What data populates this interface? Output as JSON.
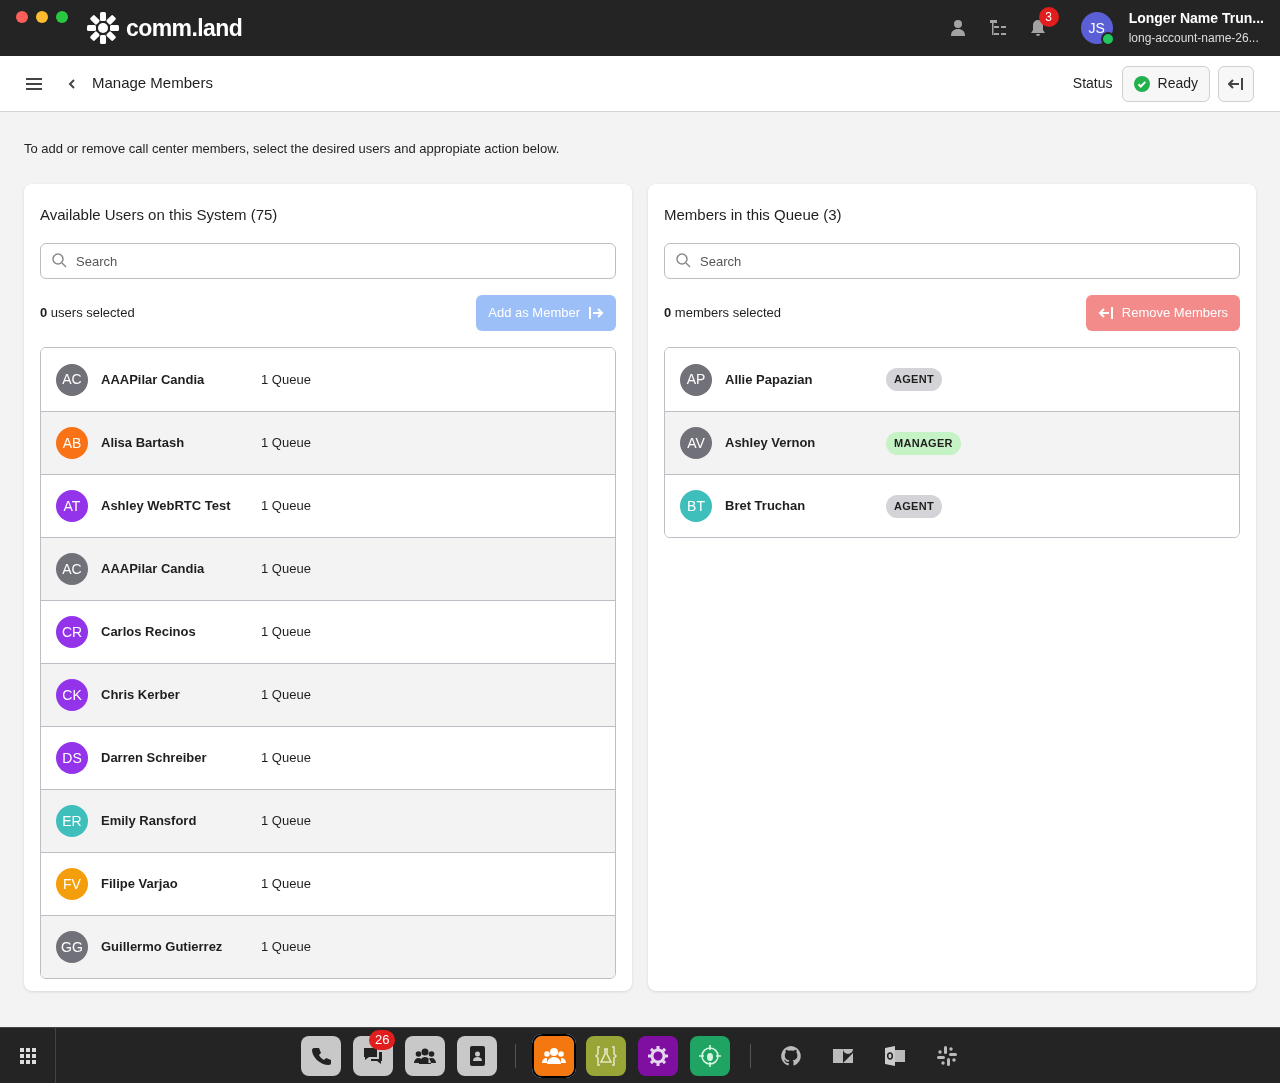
{
  "window": {
    "controls": [
      {
        "color": "#ff5f57"
      },
      {
        "color": "#febc2e"
      },
      {
        "color": "#28c840"
      }
    ]
  },
  "brand": {
    "name": "comm.land"
  },
  "top_bar": {
    "notification_count": "3",
    "user": {
      "initials": "JS",
      "name": "Longer Name Trun...",
      "account": "long-account-name-26..."
    }
  },
  "header": {
    "title": "Manage Members",
    "status_label": "Status",
    "status": "Ready"
  },
  "intro": "To add or remove call center members, select the desired users and appropiate action below.",
  "available": {
    "title": "Available Users on this System (75)",
    "search_placeholder": "Search",
    "selected_text": "**0** users selected",
    "action": "Add as Member",
    "rows": [
      {
        "initials": "AC",
        "color": "#71717a",
        "name": "AAAPilar Candia",
        "queues": "1 Queue"
      },
      {
        "initials": "AB",
        "color": "#f97316",
        "name": "Alisa Bartash",
        "queues": "1 Queue"
      },
      {
        "initials": "AT",
        "color": "#9333ea",
        "name": "Ashley WebRTC Test",
        "queues": "1 Queue"
      },
      {
        "initials": "AC",
        "color": "#71717a",
        "name": "AAAPilar Candia",
        "queues": "1 Queue"
      },
      {
        "initials": "CR",
        "color": "#9333ea",
        "name": "Carlos Recinos",
        "queues": "1 Queue"
      },
      {
        "initials": "CK",
        "color": "#9333ea",
        "name": "Chris Kerber",
        "queues": "1 Queue"
      },
      {
        "initials": "DS",
        "color": "#9333ea",
        "name": "Darren Schreiber",
        "queues": "1 Queue"
      },
      {
        "initials": "ER",
        "color": "#3fbfbc",
        "name": "Emily Ransford",
        "queues": "1 Queue"
      },
      {
        "initials": "FV",
        "color": "#f59e0b",
        "name": "Filipe Varjao",
        "queues": "1 Queue"
      },
      {
        "initials": "GG",
        "color": "#71717a",
        "name": "Guillermo Gutierrez",
        "queues": "1 Queue"
      }
    ]
  },
  "members": {
    "title": "Members in this Queue (3)",
    "search_placeholder": "Search",
    "selected_text": "**0** members selected",
    "action": "Remove Members",
    "rows": [
      {
        "initials": "AP",
        "color": "#71717a",
        "name": "Allie Papazian",
        "role": "AGENT",
        "kind": "agent"
      },
      {
        "initials": "AV",
        "color": "#71717a",
        "name": "Ashley Vernon",
        "role": "MANAGER",
        "kind": "manager"
      },
      {
        "initials": "BT",
        "color": "#3fbfbc",
        "name": "Bret Truchan",
        "role": "AGENT",
        "kind": "agent"
      }
    ]
  },
  "dock": {
    "apps": [
      {
        "kind": "phone",
        "color": "#c8c8c8",
        "selected": false
      },
      {
        "kind": "chat",
        "color": "#c8c8c8",
        "selected": false,
        "badge": "26"
      },
      {
        "kind": "people",
        "color": "#c8c8c8",
        "selected": false
      },
      {
        "kind": "contacts",
        "color": "#c8c8c8",
        "selected": false
      },
      {
        "kind": "callcenter",
        "color": "#f5770f",
        "selected": true
      },
      {
        "kind": "flask",
        "color": "#9aa537",
        "selected": false
      },
      {
        "kind": "gear",
        "color": "#7e0fa1",
        "selected": false
      },
      {
        "kind": "bug",
        "color": "#1fa463",
        "selected": false
      }
    ],
    "links": [
      {
        "kind": "github"
      },
      {
        "kind": "zendesk"
      },
      {
        "kind": "outlook"
      },
      {
        "kind": "slack"
      }
    ]
  }
}
